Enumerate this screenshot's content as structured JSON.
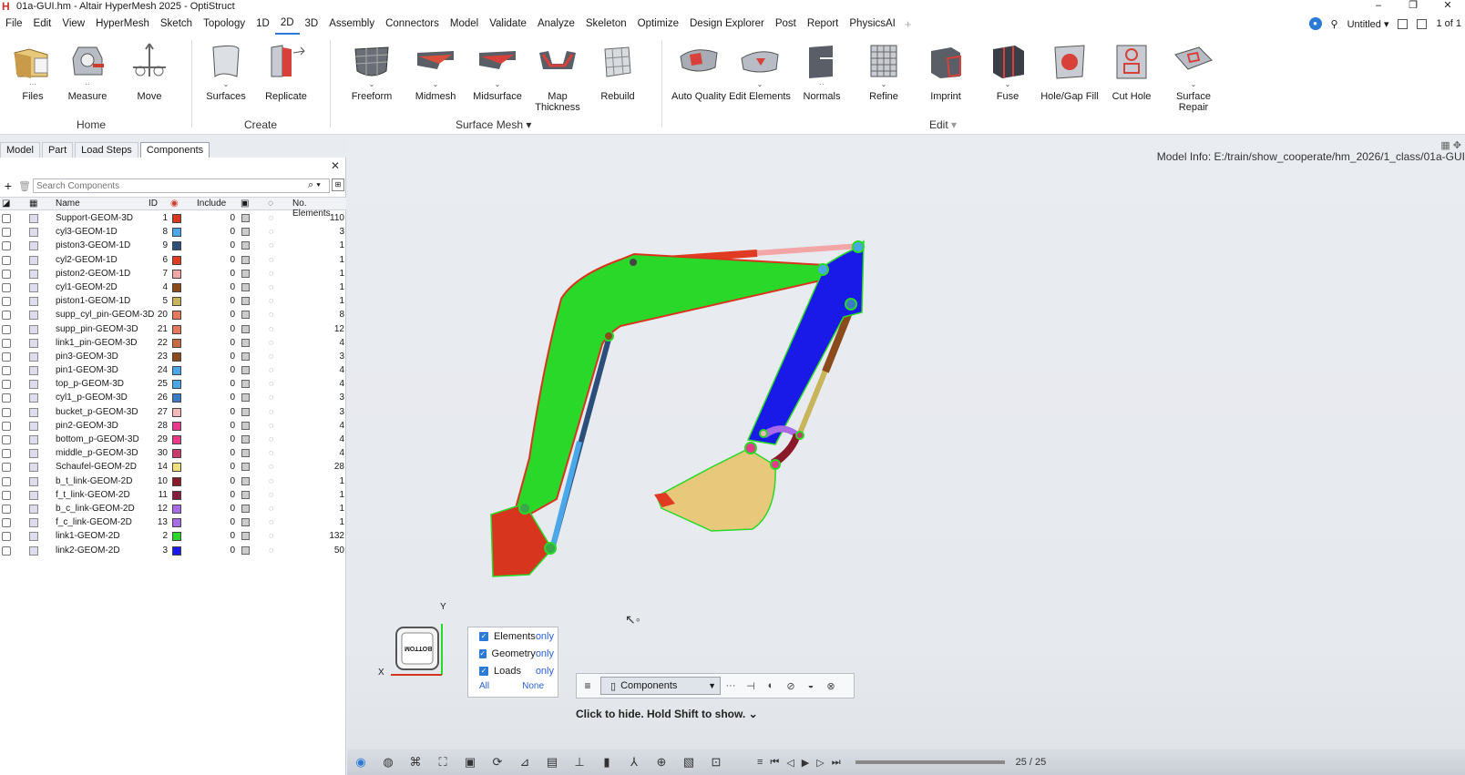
{
  "app": {
    "title": "01a-GUI.hm - Altair HyperMesh 2025 - OptiStruct",
    "logo": "H",
    "colors": {
      "accent": "#2a7ad6",
      "logo": "#d0302a"
    }
  },
  "window_controls": {
    "minimize": "–",
    "restore": "❐",
    "close": "✕"
  },
  "menu": {
    "items": [
      "File",
      "Edit",
      "View",
      "HyperMesh",
      "Sketch",
      "Topology",
      "1D",
      "2D",
      "3D",
      "Assembly",
      "Connectors",
      "Model",
      "Validate",
      "Analyze",
      "Skeleton",
      "Optimize",
      "Design Explorer",
      "Post",
      "Report",
      "PhysicsAI"
    ],
    "active": "2D",
    "add": "+",
    "session": "Untitled",
    "pages": "1 of 1"
  },
  "ribbon": {
    "groups": [
      {
        "label": "Home",
        "tools": [
          "Files",
          "Measure",
          "Move"
        ]
      },
      {
        "label": "Create",
        "tools": [
          "Surfaces",
          "Replicate"
        ]
      },
      {
        "label": "Surface Mesh",
        "tools": [
          "Freeform",
          "Midmesh",
          "Midsurface",
          "Map Thickness",
          "Rebuild"
        ]
      },
      {
        "label": "Edit",
        "tools": [
          "Auto Quality",
          "Edit Elements",
          "Normals",
          "Refine",
          "Imprint",
          "Fuse",
          "Hole/Gap Fill",
          "Cut Hole",
          "Surface Repair"
        ]
      }
    ],
    "tool_labels": {
      "files": "Files",
      "measure": "Measure",
      "move": "Move",
      "surfaces": "Surfaces",
      "replicate": "Replicate",
      "freeform": "Freeform",
      "midmesh": "Midmesh",
      "midsurface": "Midsurface",
      "map_thickness": "Map Thickness",
      "rebuild": "Rebuild",
      "auto_quality": "Auto Quality",
      "edit_elements": "Edit Elements",
      "normals": "Normals",
      "refine": "Refine",
      "imprint": "Imprint",
      "fuse": "Fuse",
      "hole_gap_fill": "Hole/Gap Fill",
      "cut_hole": "Cut Hole",
      "surface_repair": "Surface Repair"
    },
    "group_labels": {
      "home": "Home",
      "create": "Create",
      "surface_mesh": "Surface Mesh",
      "edit": "Edit"
    }
  },
  "browser": {
    "tabs": [
      "Model",
      "Part",
      "Load Steps",
      "Components"
    ],
    "active_tab": "Components",
    "search_placeholder": "Search Components",
    "add": "+",
    "columns": [
      "Name",
      "ID",
      "Include",
      "No. Elements"
    ],
    "rows": [
      {
        "name": "Support-GEOM-3D",
        "id": "1",
        "color": "#d8351f",
        "include": "0",
        "count": "110"
      },
      {
        "name": "cyl3-GEOM-1D",
        "id": "8",
        "color": "#4aa8e8",
        "include": "0",
        "count": "3"
      },
      {
        "name": "piston3-GEOM-1D",
        "id": "9",
        "color": "#2b4f7a",
        "include": "0",
        "count": "1"
      },
      {
        "name": "cyl2-GEOM-1D",
        "id": "6",
        "color": "#e03a22",
        "include": "0",
        "count": "1"
      },
      {
        "name": "piston2-GEOM-1D",
        "id": "7",
        "color": "#f2a6a6",
        "include": "0",
        "count": "1"
      },
      {
        "name": "cyl1-GEOM-2D",
        "id": "4",
        "color": "#8a4a1a",
        "include": "0",
        "count": "1"
      },
      {
        "name": "piston1-GEOM-1D",
        "id": "5",
        "color": "#c8b45a",
        "include": "0",
        "count": "1"
      },
      {
        "name": "supp_cyl_pin-GEOM-3D",
        "id": "20",
        "color": "#e8785a",
        "include": "0",
        "count": "8"
      },
      {
        "name": "supp_pin-GEOM-3D",
        "id": "21",
        "color": "#e8785a",
        "include": "0",
        "count": "12"
      },
      {
        "name": "link1_pin-GEOM-3D",
        "id": "22",
        "color": "#c86a40",
        "include": "0",
        "count": "4"
      },
      {
        "name": "pin3-GEOM-3D",
        "id": "23",
        "color": "#8a4a1a",
        "include": "0",
        "count": "3"
      },
      {
        "name": "pin1-GEOM-3D",
        "id": "24",
        "color": "#4aa8e8",
        "include": "0",
        "count": "4"
      },
      {
        "name": "top_p-GEOM-3D",
        "id": "25",
        "color": "#4aa8e8",
        "include": "0",
        "count": "4"
      },
      {
        "name": "cyl1_p-GEOM-3D",
        "id": "26",
        "color": "#3a7ac8",
        "include": "0",
        "count": "3"
      },
      {
        "name": "bucket_p-GEOM-3D",
        "id": "27",
        "color": "#f4b8b8",
        "include": "0",
        "count": "3"
      },
      {
        "name": "pin2-GEOM-3D",
        "id": "28",
        "color": "#e83a8a",
        "include": "0",
        "count": "4"
      },
      {
        "name": "bottom_p-GEOM-3D",
        "id": "29",
        "color": "#e83a8a",
        "include": "0",
        "count": "4"
      },
      {
        "name": "middle_p-GEOM-3D",
        "id": "30",
        "color": "#c83a6a",
        "include": "0",
        "count": "4"
      },
      {
        "name": "Schaufel-GEOM-2D",
        "id": "14",
        "color": "#f0e07a",
        "include": "0",
        "count": "28"
      },
      {
        "name": "b_t_link-GEOM-2D",
        "id": "10",
        "color": "#8a1a2a",
        "include": "0",
        "count": "1"
      },
      {
        "name": "f_t_link-GEOM-2D",
        "id": "11",
        "color": "#8a1a3a",
        "include": "0",
        "count": "1"
      },
      {
        "name": "b_c_link-GEOM-2D",
        "id": "12",
        "color": "#a86ae8",
        "include": "0",
        "count": "1"
      },
      {
        "name": "f_c_link-GEOM-2D",
        "id": "13",
        "color": "#a86ae8",
        "include": "0",
        "count": "1"
      },
      {
        "name": "link1-GEOM-2D",
        "id": "2",
        "color": "#2ad82a",
        "include": "0",
        "count": "132"
      },
      {
        "name": "link2-GEOM-2D",
        "id": "3",
        "color": "#1a1ae8",
        "include": "0",
        "count": "50"
      }
    ]
  },
  "viewport": {
    "model_info": "Model Info: E:/train/show_cooperate/hm_2026/1_class/01a-GUI",
    "triad": {
      "y": "Y",
      "x": "X",
      "cube_face": "BOTTOM"
    },
    "filters": {
      "items": [
        {
          "label": "Elements",
          "only": "only"
        },
        {
          "label": "Geometry",
          "only": "only"
        },
        {
          "label": "Loads",
          "only": "only"
        }
      ],
      "all": "All",
      "none": "None"
    },
    "selector": {
      "entity": "Components"
    },
    "hint": "Click to hide. Hold Shift to show.",
    "animation": {
      "frame": "25 / 25"
    }
  }
}
